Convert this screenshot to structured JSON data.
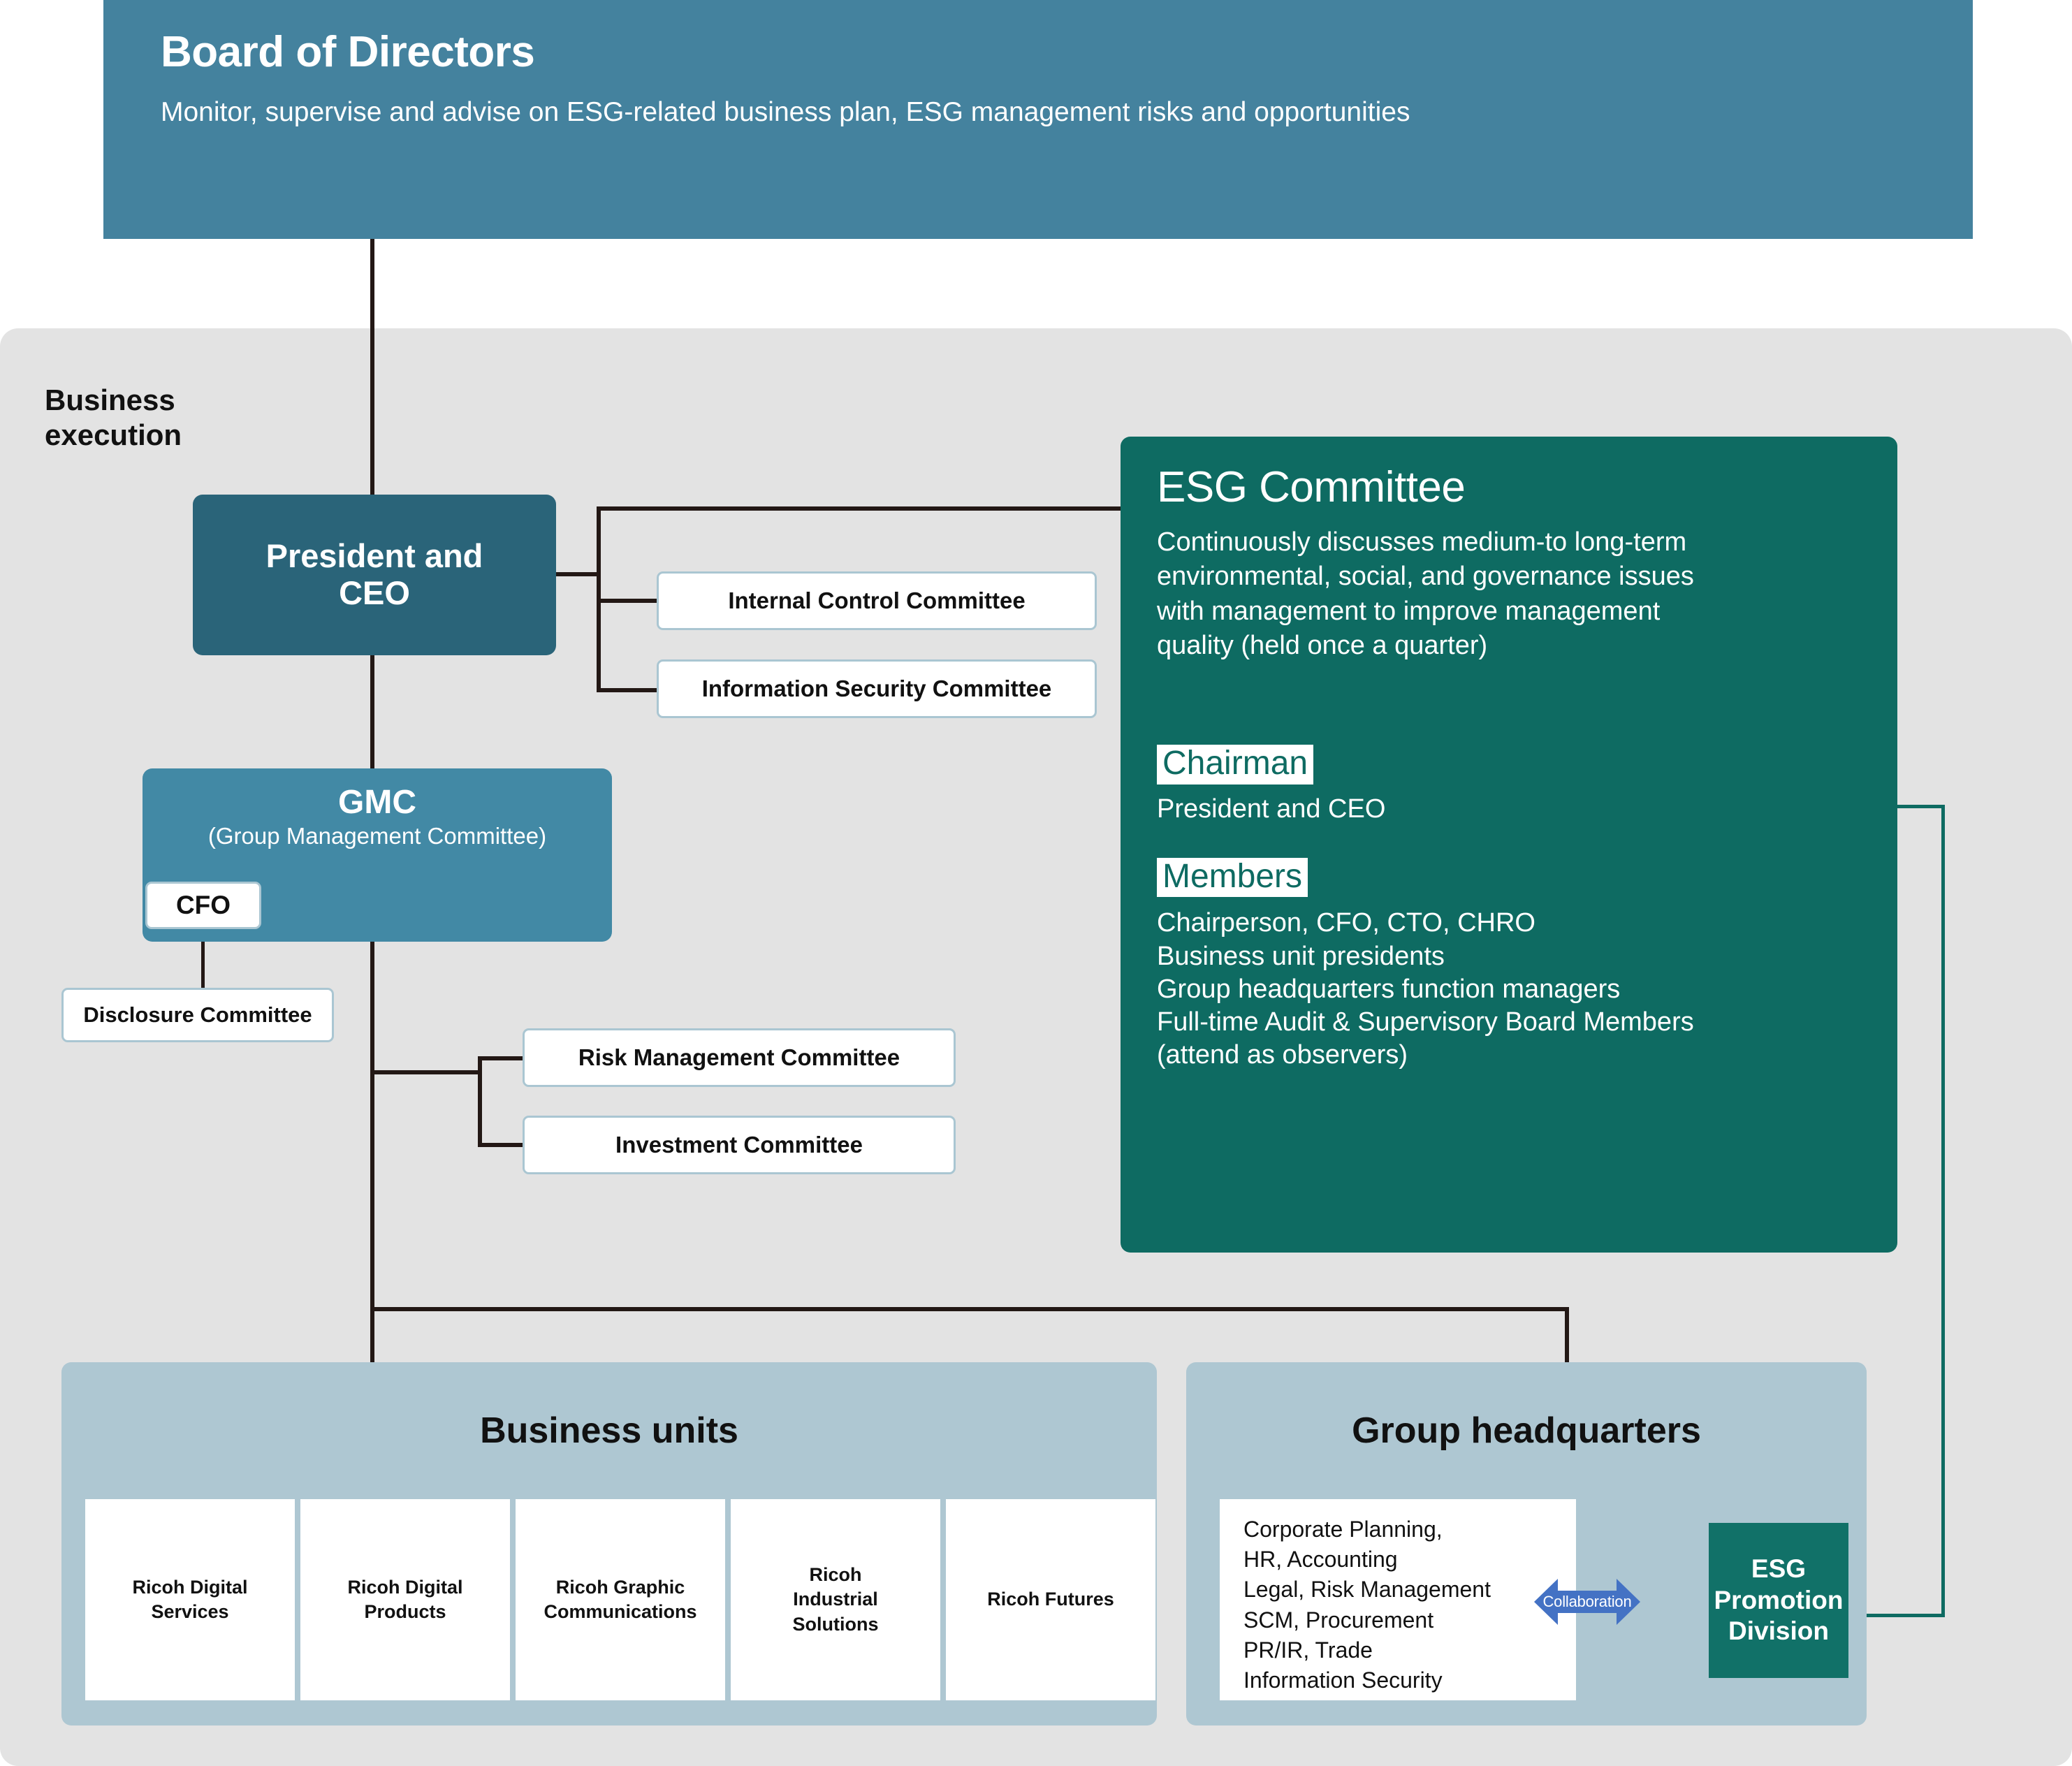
{
  "board": {
    "title": "Board of Directors",
    "subtitle": "Monitor, supervise and advise on ESG-related business plan, ESG management risks and opportunities"
  },
  "execution": {
    "label": "Business\nexecution"
  },
  "ceo": {
    "label": "President and\nCEO"
  },
  "gmc": {
    "title": "GMC",
    "subtitle": "(Group Management Committee)",
    "cfo_label": "CFO",
    "disclosure_label": "Disclosure Committee"
  },
  "ceo_committees": [
    {
      "label": "Internal Control Committee"
    },
    {
      "label": "Information Security Committee"
    }
  ],
  "gmc_committees": [
    {
      "label": "Risk Management Committee"
    },
    {
      "label": "Investment Committee"
    }
  ],
  "esg_committee": {
    "title": "ESG Committee",
    "description": "Continuously discusses medium-to long-term\nenvironmental, social, and governance issues\nwith management to improve management\nquality (held once a quarter)",
    "chairman_heading": "Chairman",
    "chairman_value": "President and CEO",
    "members_heading": "Members",
    "members_value": "Chairperson, CFO, CTO, CHRO\nBusiness unit presidents\nGroup headquarters function managers\nFull-time Audit & Supervisory Board Members\n(attend as observers)"
  },
  "business_units": {
    "title": "Business units",
    "units": [
      {
        "label": "Ricoh Digital\nServices"
      },
      {
        "label": "Ricoh Digital\nProducts"
      },
      {
        "label": "Ricoh Graphic\nCommunications"
      },
      {
        "label": "Ricoh\nIndustrial\nSolutions"
      },
      {
        "label": "Ricoh Futures"
      }
    ]
  },
  "group_headquarters": {
    "title": "Group headquarters",
    "functions": "Corporate Planning,\nHR, Accounting\nLegal, Risk Management\nSCM, Procurement\nPR/IR, Trade\nInformation Security",
    "collaboration_label": "Collaboration",
    "esg_promotion_division": "ESG\nPromotion\nDivision"
  },
  "colors": {
    "board_blue": "#44829E",
    "ceo_blue": "#2A6479",
    "gmc_blue": "#4289A5",
    "esg_green": "#0E6B62",
    "esg_pd_green": "#117168",
    "panel_gray": "#e3e3e3",
    "light_blue_panel": "#aec7d2",
    "box_border": "#aac6d2",
    "connector": "#231815",
    "collab_arrow": "#4472C4"
  }
}
